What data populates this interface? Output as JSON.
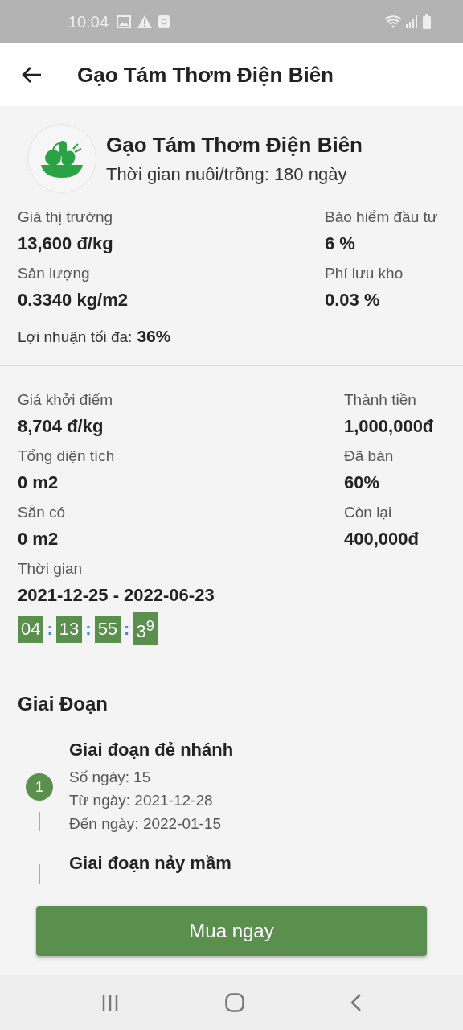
{
  "status_bar": {
    "time": "10:04"
  },
  "header": {
    "title": "Gạo Tám Thơm Điện Biên"
  },
  "product": {
    "name": "Gạo Tám Thơm Điện Biên",
    "subtitle": "Thời gian nuôi/trồng: 180 ngày"
  },
  "market": {
    "rows": [
      {
        "left": {
          "label": "Giá thị trường",
          "value": "13,600 đ/kg"
        },
        "right": {
          "label": "Bảo hiểm đầu tư",
          "value": "6 %"
        }
      },
      {
        "left": {
          "label": "Sản lượng",
          "value": "0.3340 kg/m2"
        },
        "right": {
          "label": "Phí lưu kho",
          "value": "0.03 %"
        }
      }
    ],
    "profit": {
      "label": "Lợi nhuận tối đa:",
      "value": "36%"
    }
  },
  "offer": {
    "rows": [
      {
        "left": {
          "label": "Giá khởi điểm",
          "value": "8,704 đ/kg"
        },
        "right": {
          "label": "Thành tiền",
          "value": "1,000,000đ"
        }
      },
      {
        "left": {
          "label": "Tổng diện tích",
          "value": "0 m2"
        },
        "right": {
          "label": "Đã bán",
          "value": "60%"
        }
      },
      {
        "left": {
          "label": "Sẵn có",
          "value": "0 m2"
        },
        "right": {
          "label": "Còn lại",
          "value": "400,000đ"
        }
      }
    ],
    "period": {
      "label": "Thời gian",
      "value": "2021-12-25 - 2022-06-23"
    },
    "countdown": [
      {
        "kind": "digits",
        "text": "04"
      },
      {
        "kind": "separator",
        "text": ":"
      },
      {
        "kind": "digits",
        "text": "13"
      },
      {
        "kind": "separator",
        "text": ":"
      },
      {
        "kind": "digits",
        "text": "55"
      },
      {
        "kind": "separator",
        "text": ":"
      },
      {
        "kind": "digits",
        "text": "3$^{9}$"
      }
    ]
  },
  "stages": {
    "title": "Giai Đoạn",
    "items": [
      {
        "number": "1",
        "title": "Giai đoạn đẻ nhánh",
        "lines": [
          "Số ngày: 15",
          "Từ ngày: 2021-12-28",
          "Đến ngày: 2022-01-15"
        ]
      },
      {
        "title": "Giai đoạn nảy mầm"
      }
    ]
  },
  "buy_button": {
    "label": "Mua ngay"
  }
}
